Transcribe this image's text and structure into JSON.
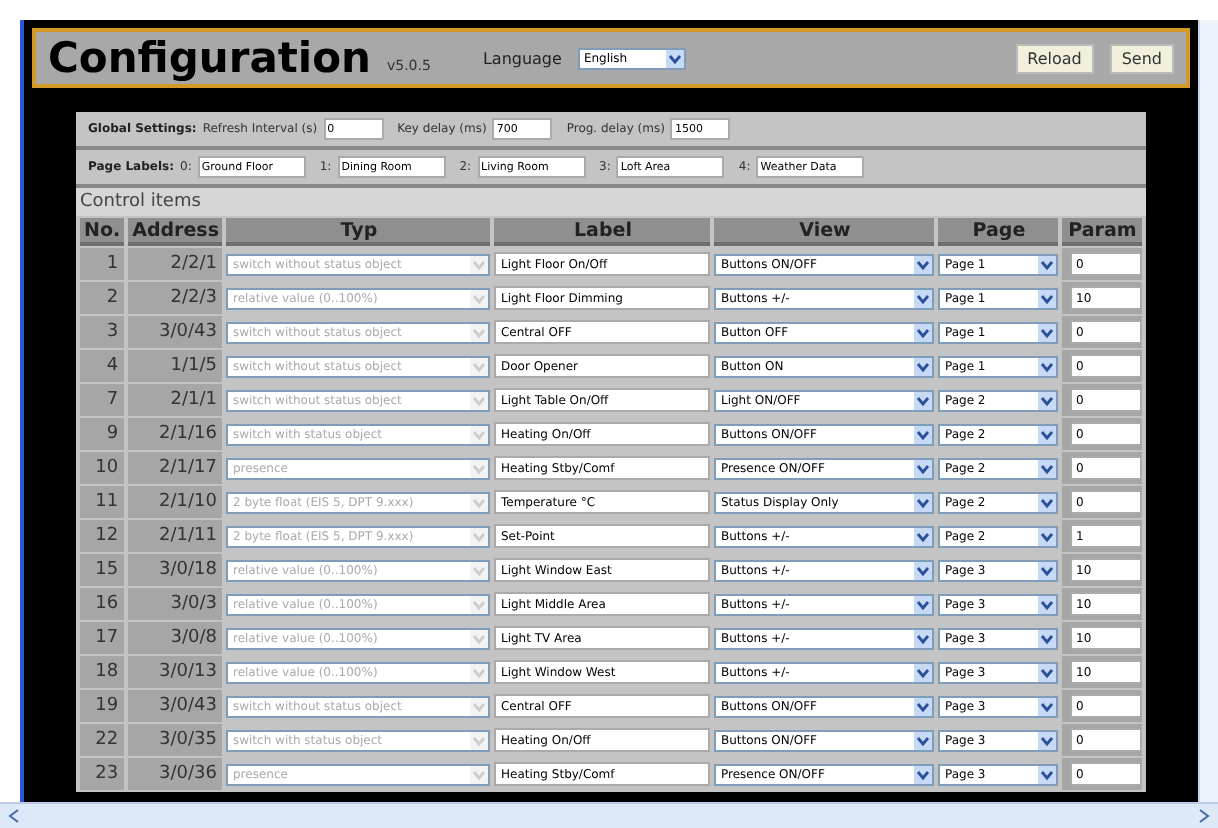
{
  "header": {
    "title": "Configuration",
    "version": "v5.0.5",
    "language_label": "Language",
    "language": "English",
    "buttons": [
      "Reload",
      "Send"
    ]
  },
  "global_settings": {
    "label": "Global Settings:",
    "fields": [
      {
        "label": "Refresh Interval (s)",
        "value": "0"
      },
      {
        "label": "Key delay (ms)",
        "value": "700"
      },
      {
        "label": "Prog. delay (ms)",
        "value": "1500"
      }
    ]
  },
  "page_labels": {
    "label": "Page Labels:",
    "fields": [
      {
        "label": "0:",
        "value": "Ground Floor"
      },
      {
        "label": "1:",
        "value": "Dining Room"
      },
      {
        "label": "2:",
        "value": "Living Room"
      },
      {
        "label": "3:",
        "value": "Loft Area"
      },
      {
        "label": "4:",
        "value": "Weather Data"
      }
    ]
  },
  "control_items": {
    "title": "Control items",
    "columns": [
      "No.",
      "Address",
      "Typ",
      "Label",
      "View",
      "Page",
      "Param"
    ],
    "rows": [
      {
        "no": "1",
        "address": "2/2/1",
        "typ": "switch without status object",
        "typ_disabled": true,
        "label": "Light Floor On/Off",
        "view": "Buttons ON/OFF",
        "page": "Page 1",
        "param": "0"
      },
      {
        "no": "2",
        "address": "2/2/3",
        "typ": "relative value (0..100%)",
        "typ_disabled": true,
        "label": "Light Floor Dimming",
        "view": "Buttons +/-",
        "page": "Page 1",
        "param": "10"
      },
      {
        "no": "3",
        "address": "3/0/43",
        "typ": "switch without status object",
        "typ_disabled": true,
        "label": "Central OFF",
        "view": "Button OFF",
        "page": "Page 1",
        "param": "0"
      },
      {
        "no": "4",
        "address": "1/1/5",
        "typ": "switch without status object",
        "typ_disabled": true,
        "label": "Door Opener",
        "view": "Button ON",
        "page": "Page 1",
        "param": "0"
      },
      {
        "no": "7",
        "address": "2/1/1",
        "typ": "switch without status object",
        "typ_disabled": true,
        "label": "Light Table On/Off",
        "view": "Light ON/OFF",
        "page": "Page 2",
        "param": "0"
      },
      {
        "no": "9",
        "address": "2/1/16",
        "typ": "switch with status object",
        "typ_disabled": true,
        "label": "Heating On/Off",
        "view": "Buttons ON/OFF",
        "page": "Page 2",
        "param": "0"
      },
      {
        "no": "10",
        "address": "2/1/17",
        "typ": "presence",
        "typ_disabled": true,
        "label": "Heating Stby/Comf",
        "view": "Presence ON/OFF",
        "page": "Page 2",
        "param": "0"
      },
      {
        "no": "11",
        "address": "2/1/10",
        "typ": "2 byte float (EIS 5, DPT 9.xxx)",
        "typ_disabled": true,
        "label": "Temperature °C",
        "view": "Status Display Only",
        "page": "Page 2",
        "param": "0"
      },
      {
        "no": "12",
        "address": "2/1/11",
        "typ": "2 byte float (EIS 5, DPT 9.xxx)",
        "typ_disabled": true,
        "label": "Set-Point",
        "view": "Buttons +/-",
        "page": "Page 2",
        "param": "1"
      },
      {
        "no": "15",
        "address": "3/0/18",
        "typ": "relative value (0..100%)",
        "typ_disabled": true,
        "label": "Light Window East",
        "view": "Buttons +/-",
        "page": "Page 3",
        "param": "10"
      },
      {
        "no": "16",
        "address": "3/0/3",
        "typ": "relative value (0..100%)",
        "typ_disabled": true,
        "label": "Light Middle Area",
        "view": "Buttons +/-",
        "page": "Page 3",
        "param": "10"
      },
      {
        "no": "17",
        "address": "3/0/8",
        "typ": "relative value (0..100%)",
        "typ_disabled": true,
        "label": "Light TV Area",
        "view": "Buttons +/-",
        "page": "Page 3",
        "param": "10"
      },
      {
        "no": "18",
        "address": "3/0/13",
        "typ": "relative value (0..100%)",
        "typ_disabled": true,
        "label": "Light Window West",
        "view": "Buttons +/-",
        "page": "Page 3",
        "param": "10"
      },
      {
        "no": "19",
        "address": "3/0/43",
        "typ": "switch without status object",
        "typ_disabled": true,
        "label": "Central OFF",
        "view": "Buttons ON/OFF",
        "page": "Page 3",
        "param": "0"
      },
      {
        "no": "22",
        "address": "3/0/35",
        "typ": "switch with status object",
        "typ_disabled": true,
        "label": "Heating On/Off",
        "view": "Buttons ON/OFF",
        "page": "Page 3",
        "param": "0"
      },
      {
        "no": "23",
        "address": "3/0/36",
        "typ": "presence",
        "typ_disabled": true,
        "label": "Heating Stby/Comf",
        "view": "Presence ON/OFF",
        "page": "Page 3",
        "param": "0"
      }
    ]
  }
}
